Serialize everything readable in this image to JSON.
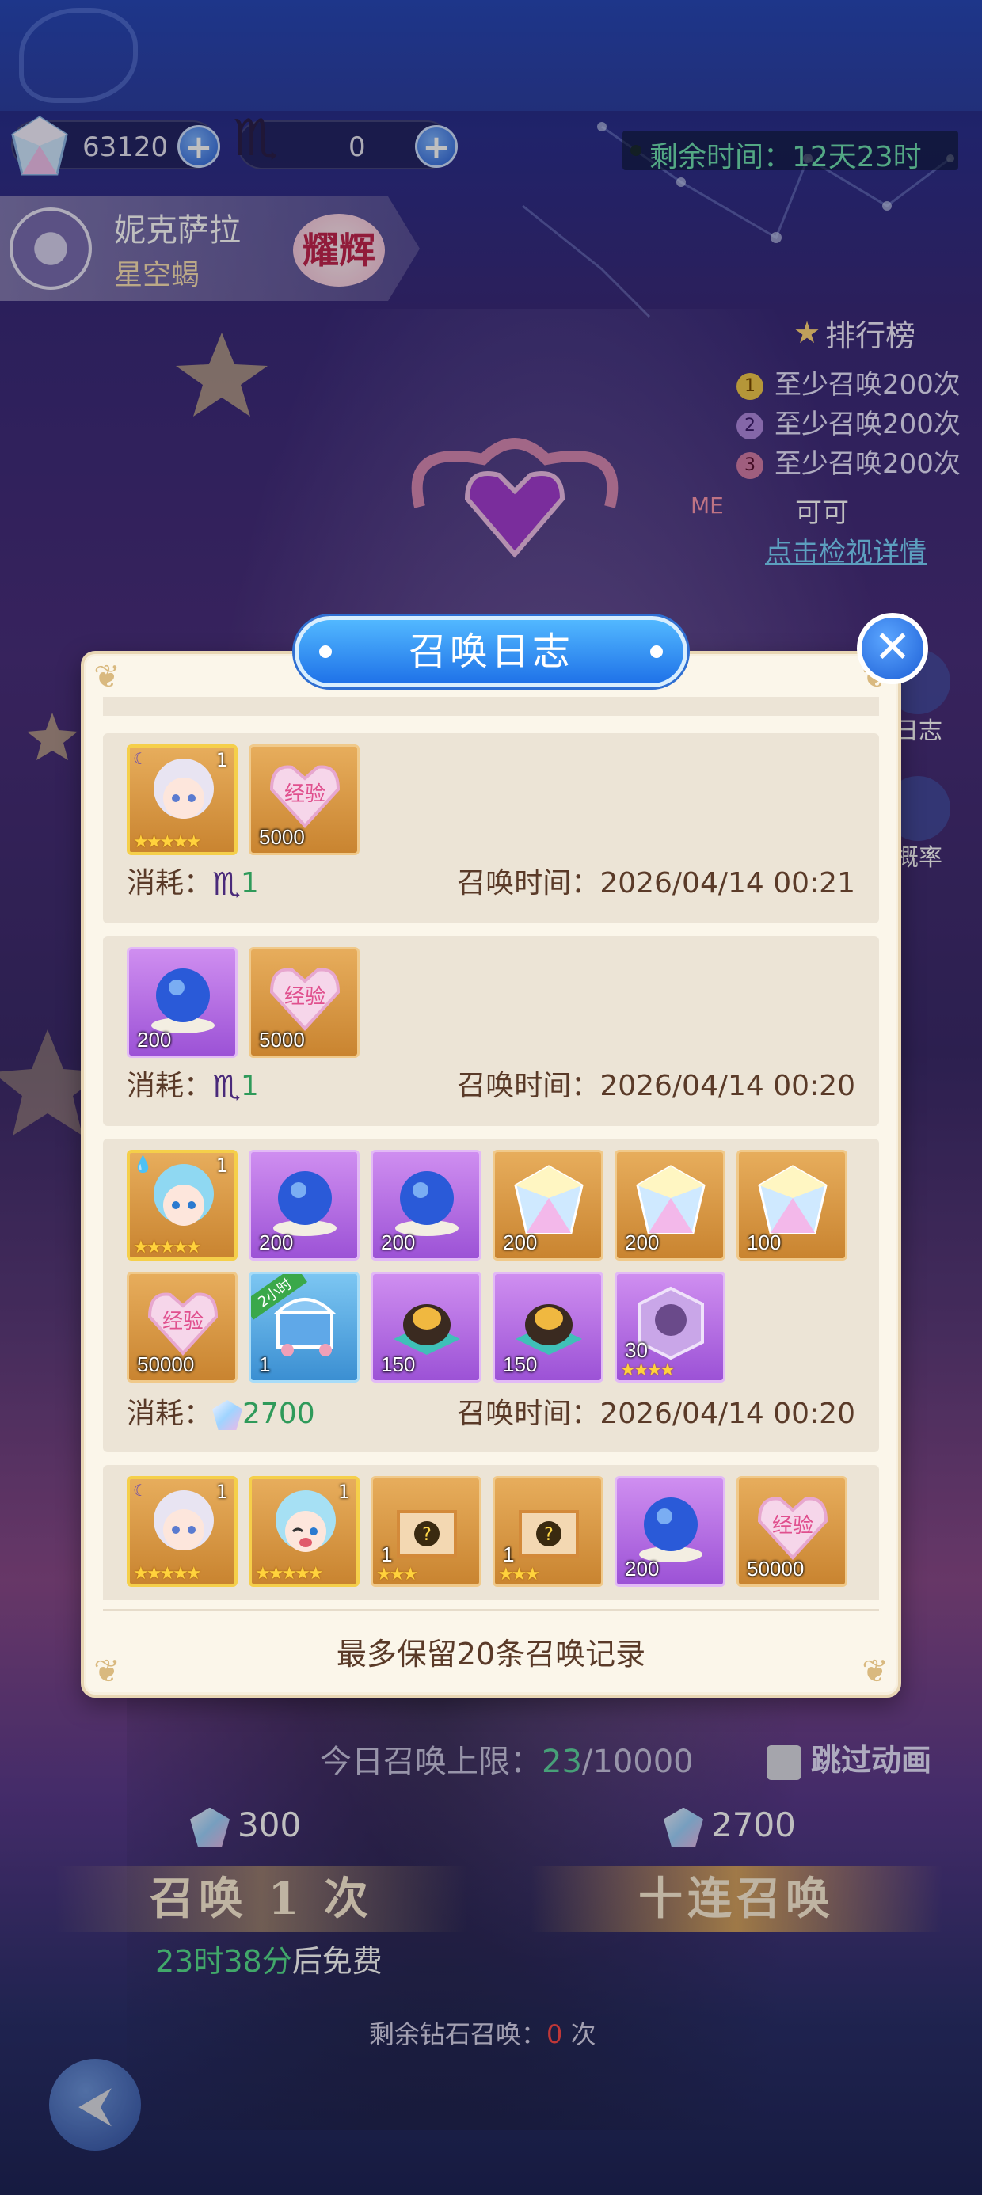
{
  "currency": {
    "gems": "63120",
    "scorpion_tokens": "0",
    "plus_symbol": "+"
  },
  "timer": {
    "label": "剩余时间：12天23时"
  },
  "hero": {
    "name": "妮克萨拉",
    "title": "星空蝎",
    "badge": "耀辉"
  },
  "ranking": {
    "title": "排行榜",
    "rows": [
      {
        "num": "1",
        "text": "至少召唤200次"
      },
      {
        "num": "2",
        "text": "至少召唤200次"
      },
      {
        "num": "3",
        "text": "至少召唤200次"
      }
    ],
    "me_label": "ME",
    "me_value": "可可",
    "link": "点击检视详情"
  },
  "side": {
    "log_label": "日志",
    "prob_label": "概率"
  },
  "dialog": {
    "title": "召唤日志",
    "close_symbol": "✕",
    "footer": "最多保留20条召唤记录",
    "cost_label": "消耗：",
    "time_label": "召唤时间：",
    "entries": [
      {
        "cost_currency": "scorpion",
        "cost_value": "1",
        "time": "2026/04/14 00:21",
        "items": [
          {
            "type": "portrait-silver",
            "level": "1",
            "stars": "★★★★★"
          },
          {
            "type": "exp-heart",
            "qty": "5000"
          }
        ]
      },
      {
        "cost_currency": "scorpion",
        "cost_value": "1",
        "time": "2026/04/14 00:20",
        "items": [
          {
            "type": "star-orb",
            "qty": "200"
          },
          {
            "type": "exp-heart",
            "qty": "5000"
          }
        ]
      },
      {
        "cost_currency": "gem",
        "cost_value": "2700",
        "time": "2026/04/14 00:20",
        "items": [
          {
            "type": "portrait-cyan",
            "level": "1",
            "stars": "★★★★★"
          },
          {
            "type": "star-orb",
            "qty": "200"
          },
          {
            "type": "star-orb",
            "qty": "200"
          },
          {
            "type": "crystal",
            "qty": "200"
          },
          {
            "type": "crystal",
            "qty": "200"
          },
          {
            "type": "crystal",
            "qty": "100"
          },
          {
            "type": "exp-heart",
            "qty": "50000"
          },
          {
            "type": "treasure-chest",
            "qty": "1",
            "ribbon": "2小时"
          },
          {
            "type": "gold-egg",
            "qty": "150"
          },
          {
            "type": "gold-egg",
            "qty": "150"
          },
          {
            "type": "shadow-cube",
            "qty": "30",
            "stars": "★★★★"
          }
        ]
      },
      {
        "items": [
          {
            "type": "portrait-silver",
            "level": "1",
            "stars": "★★★★★"
          },
          {
            "type": "portrait-cyan-wink",
            "level": "1",
            "stars": "★★★★★"
          },
          {
            "type": "mystery-box",
            "qty": "1",
            "stars": "★★★"
          },
          {
            "type": "mystery-box",
            "qty": "1",
            "stars": "★★★"
          },
          {
            "type": "star-orb",
            "qty": "200"
          },
          {
            "type": "exp-heart",
            "qty": "50000"
          }
        ]
      }
    ],
    "exp_text": "经验"
  },
  "bottom": {
    "limit_label": "今日召唤上限：",
    "limit_used": "23",
    "limit_total": "/10000",
    "skip_label": "跳过动画",
    "cost_one": "300",
    "cost_ten": "2700",
    "btn_one": "召唤 1 次",
    "btn_ten": "十连召唤",
    "free_time": "23时38分",
    "free_suffix": "后免费",
    "remain_label": "剩余钻石召唤：",
    "remain_count": "0",
    "remain_unit": " 次"
  },
  "colors": {
    "accent_blue": "#1f72e8",
    "dialog_bg": "#fbf6ea",
    "cost_green": "#2f9a5a",
    "item_gold": "#c98430",
    "item_purple": "#9c52d6"
  }
}
